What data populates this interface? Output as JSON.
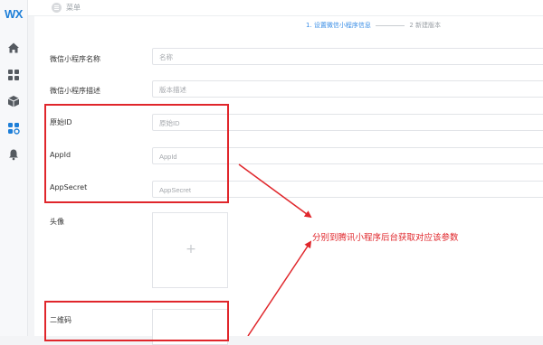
{
  "app": {
    "logo_text": "WX"
  },
  "sidebar": {
    "items": [
      {
        "icon": "home-icon"
      },
      {
        "icon": "grid-icon"
      },
      {
        "icon": "cube-icon"
      },
      {
        "icon": "apps-settings-icon",
        "active": true
      },
      {
        "icon": "bell-icon"
      }
    ]
  },
  "topbar": {
    "menu_label": "菜单"
  },
  "steps": {
    "step1": "1. 设置微信小程序信息",
    "step2": "2 新建版本"
  },
  "form": {
    "name": {
      "label": "微信小程序名称",
      "placeholder": "名称"
    },
    "desc": {
      "label": "微信小程序描述",
      "placeholder": "版本描述"
    },
    "original_id": {
      "label": "原始ID",
      "placeholder": "原始ID"
    },
    "appid": {
      "label": "AppId",
      "placeholder": "AppId"
    },
    "appsecret": {
      "label": "AppSecret",
      "placeholder": "AppSecret"
    },
    "avatar": {
      "label": "头像",
      "upload_symbol": "+"
    },
    "qrcode": {
      "label": "二维码"
    }
  },
  "annotation": {
    "text": "分别到腾讯小程序后台获取对应该参数",
    "color": "#e0262b"
  },
  "colors": {
    "accent": "#3a8ee6",
    "logo": "#1e7fd8",
    "annotation_red": "#e0262b"
  }
}
